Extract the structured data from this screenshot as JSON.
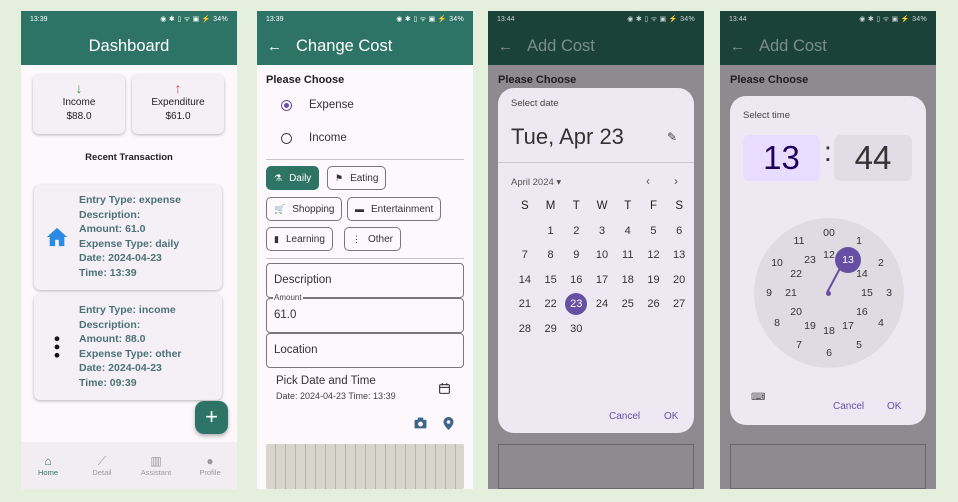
{
  "status_bars": [
    {
      "time": "13:39",
      "icons": "◉ ✱ ▯ ᯤ ▣ ⚡",
      "battery": "34%"
    },
    {
      "time": "13:39",
      "icons": "◉ ✱ ▯ ᯤ ▣ ⚡",
      "battery": "34%"
    },
    {
      "time": "13:44",
      "icons": "◉ ✱ ▯ ᯤ ▣ ⚡",
      "battery": "34%"
    },
    {
      "time": "13:44",
      "icons": "◉ ✱ ▯ ᯤ ▣ ⚡",
      "battery": "34%"
    }
  ],
  "dashboard": {
    "title": "Dashboard",
    "income": {
      "label": "Income",
      "value": "$88.0",
      "arrow": "↓"
    },
    "expenditure": {
      "label": "Expenditure",
      "value": "$61.0",
      "arrow": "↑"
    },
    "recent_title": "Recent Transaction",
    "transactions": [
      {
        "entry": "Entry Type: expense",
        "desc": "Description:",
        "amount": "Amount: 61.0",
        "type": "Expense Type: daily",
        "date": "Date: 2024-04-23",
        "time": "Time: 13:39",
        "icon": "home-icon"
      },
      {
        "entry": "Entry Type: income",
        "desc": "Description:",
        "amount": "Amount: 88.0",
        "type": "Expense Type: other",
        "date": "Date: 2024-04-23",
        "time": "Time: 09:39",
        "icon": "more-vertical-icon"
      }
    ],
    "fab": "+",
    "nav": [
      {
        "label": "Home",
        "glyph": "⌂"
      },
      {
        "label": "Detail",
        "glyph": "⟋"
      },
      {
        "label": "Assistant",
        "glyph": "▥"
      },
      {
        "label": "Profile",
        "glyph": "●"
      }
    ],
    "colors": {
      "primary": "#2e7466",
      "income_arrow": "#3a9c4c",
      "expense_arrow": "#d0493d",
      "home_icon": "#2b8ae6"
    }
  },
  "change_cost": {
    "title": "Change Cost",
    "back": "←",
    "prompt": "Please Choose",
    "options": [
      "Expense",
      "Income"
    ],
    "categories": [
      {
        "label": "Daily",
        "glyph": "⚗"
      },
      {
        "label": "Eating",
        "glyph": "⚑"
      },
      {
        "label": "Shopping",
        "glyph": "🛒"
      },
      {
        "label": "Entertainment",
        "glyph": "▬"
      },
      {
        "label": "Learning",
        "glyph": "▮"
      },
      {
        "label": "Other",
        "glyph": "⋮"
      }
    ],
    "description_placeholder": "Description",
    "amount_label": "Amount",
    "amount_value": "61.0",
    "location_placeholder": "Location",
    "pick_title": "Pick Date and Time",
    "pick_value": "Date: 2024-04-23 Time: 13:39"
  },
  "add_cost_title": "Add Cost",
  "date_picker": {
    "header": "Select date",
    "big_date": "Tue, Apr 23",
    "month": "April 2024 ▾",
    "weekdays": [
      "S",
      "M",
      "T",
      "W",
      "T",
      "F",
      "S"
    ],
    "weeks": [
      [
        "",
        "1",
        "2",
        "3",
        "4",
        "5",
        "6"
      ],
      [
        "7",
        "8",
        "9",
        "10",
        "11",
        "12",
        "13"
      ],
      [
        "14",
        "15",
        "16",
        "17",
        "18",
        "19",
        "20"
      ],
      [
        "21",
        "22",
        "23",
        "24",
        "25",
        "26",
        "27"
      ],
      [
        "28",
        "29",
        "30",
        "",
        "",
        "",
        ""
      ]
    ],
    "selected": "23",
    "cancel": "Cancel",
    "ok": "OK"
  },
  "time_picker": {
    "header": "Select time",
    "hour": "13",
    "sep": ":",
    "minute": "44",
    "cancel": "Cancel",
    "ok": "OK",
    "outer": [
      "00",
      "1",
      "2",
      "3",
      "4",
      "5",
      "6",
      "7",
      "8",
      "9",
      "10",
      "11"
    ],
    "inner": [
      "12",
      "13",
      "14",
      "15",
      "16",
      "17",
      "18",
      "19",
      "20",
      "21",
      "22",
      "23"
    ],
    "selected": "13"
  }
}
